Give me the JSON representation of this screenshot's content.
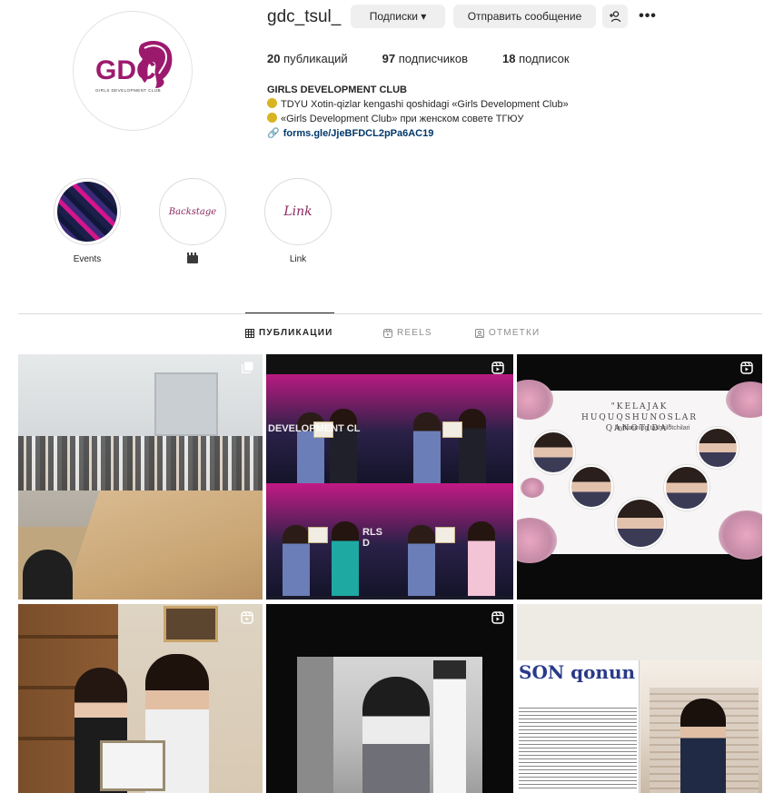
{
  "profile": {
    "username": "gdc_tsul_",
    "avatar_logo_text": "GDC",
    "avatar_logo_subtitle": "GIRLS DEVELOPMENT CLUB",
    "buttons": {
      "follow": "Подписки ▾",
      "message": "Отправить сообщение",
      "add_user": "+",
      "more": "•••"
    },
    "stats": [
      {
        "count": "20",
        "label": "публикаций"
      },
      {
        "count": "97",
        "label": "подписчиков"
      },
      {
        "count": "18",
        "label": "подписок"
      }
    ],
    "bio": {
      "name": "GIRLS DEVELOPMENT CLUB",
      "line1": "TDYU Xotin-qizlar kengashi qoshidagi «Girls Development Club»",
      "line2": "«Girls Development Club» при женском совете ТГЮУ",
      "link": "forms.gle/JjeBFDCL2pPa6AC19"
    }
  },
  "highlights": [
    {
      "label": "Events",
      "cover": ""
    },
    {
      "label": "",
      "cover": "Backstage"
    },
    {
      "label": "Link",
      "cover": "Link"
    }
  ],
  "tabs": [
    {
      "label": "ПУБЛИКАЦИИ",
      "icon": "grid-icon",
      "active": true
    },
    {
      "label": "REELS",
      "icon": "reels-icon",
      "active": false
    },
    {
      "label": "ОТМЕТКИ",
      "icon": "tag-icon",
      "active": false
    }
  ],
  "posts": [
    {
      "type_icon": "multi-image-icon"
    },
    {
      "type_icon": "reels-icon",
      "overlay_text_left": "DEVELOPMENT CL",
      "overlay_text_right": "RLS D"
    },
    {
      "type_icon": "reels-icon",
      "title": "\"KELAJAK HUQUQSHUNOSLAR QANOTIDA\"",
      "subtitle": "loyihasining tashkilotchilari"
    },
    {
      "type_icon": "reels-icon"
    },
    {
      "type_icon": "reels-icon"
    },
    {
      "type_icon": "",
      "newspaper_title": "SON qonun"
    }
  ],
  "colors": {
    "brand": "#9c1a6e",
    "link": "#00376b",
    "button_bg": "#efefef",
    "text": "#262626"
  }
}
